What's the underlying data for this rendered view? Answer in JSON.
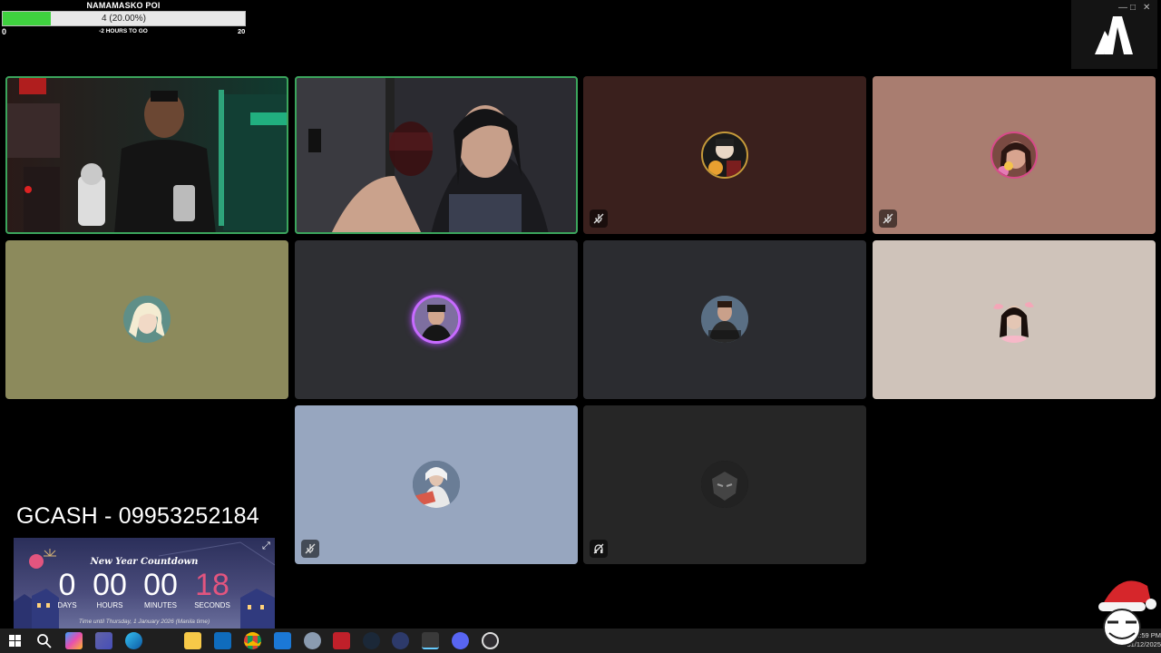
{
  "goal": {
    "title": "NAMAMASKO POI",
    "progress_text": "4 (20.00%)",
    "progress_fraction": 0.2,
    "min": "0",
    "max": "20",
    "subtitle": "-2 HOURS TO GO",
    "fill_color": "#3fd13f"
  },
  "window_controls": {
    "minimize": "—",
    "maximize": "□",
    "close": "✕"
  },
  "logo": {
    "icon": "abstract-a-logo"
  },
  "tiles": [
    {
      "name": "participant-video-1",
      "kind": "video",
      "bg": "#1b1f22",
      "speaking": true
    },
    {
      "name": "participant-video-2",
      "kind": "video",
      "bg": "#2a2a30",
      "speaking": true
    },
    {
      "name": "participant-3",
      "kind": "avatar",
      "bg": "#3a201d",
      "muted": true
    },
    {
      "name": "participant-4",
      "kind": "avatar",
      "bg": "#a97d70",
      "muted": true
    },
    {
      "name": "participant-5",
      "kind": "avatar",
      "bg": "#8c8a5c",
      "muted": false
    },
    {
      "name": "participant-6",
      "kind": "avatar",
      "bg": "#2e2f33",
      "muted": false
    },
    {
      "name": "participant-7",
      "kind": "avatar",
      "bg": "#2b2c30",
      "muted": false
    },
    {
      "name": "participant-8",
      "kind": "avatar",
      "bg": "#cfc3ba",
      "muted": false
    },
    {
      "name": "participant-9",
      "kind": "avatar",
      "bg": "#97a6bf",
      "muted": true
    },
    {
      "name": "participant-10",
      "kind": "avatar",
      "bg": "#262626",
      "muted": true
    }
  ],
  "gcash_text": "GCASH - 09953252184",
  "countdown": {
    "title": "New Year Countdown",
    "days": "0",
    "hours": "00",
    "minutes": "00",
    "seconds": "18",
    "days_label": "DAYS",
    "hours_label": "HOURS",
    "minutes_label": "MINUTES",
    "seconds_label": "SECONDS",
    "footer": "Time until Thursday, 1 January 2026 (Manila time)",
    "seconds_color": "#e2557f"
  },
  "taskbar": {
    "clock_time": "11:59 PM",
    "clock_date": "31/12/2025",
    "icons": [
      "windows-start-icon",
      "search-icon",
      "copilot-icon",
      "teams-icon",
      "edge-icon",
      "file-explorer-icon",
      "outlook-icon",
      "chrome-icon",
      "store-icon",
      "app-icon",
      "video-app-icon",
      "steam-icon",
      "grid-app-icon",
      "pinned-app-icon",
      "chat-app-icon",
      "obs-icon"
    ]
  }
}
